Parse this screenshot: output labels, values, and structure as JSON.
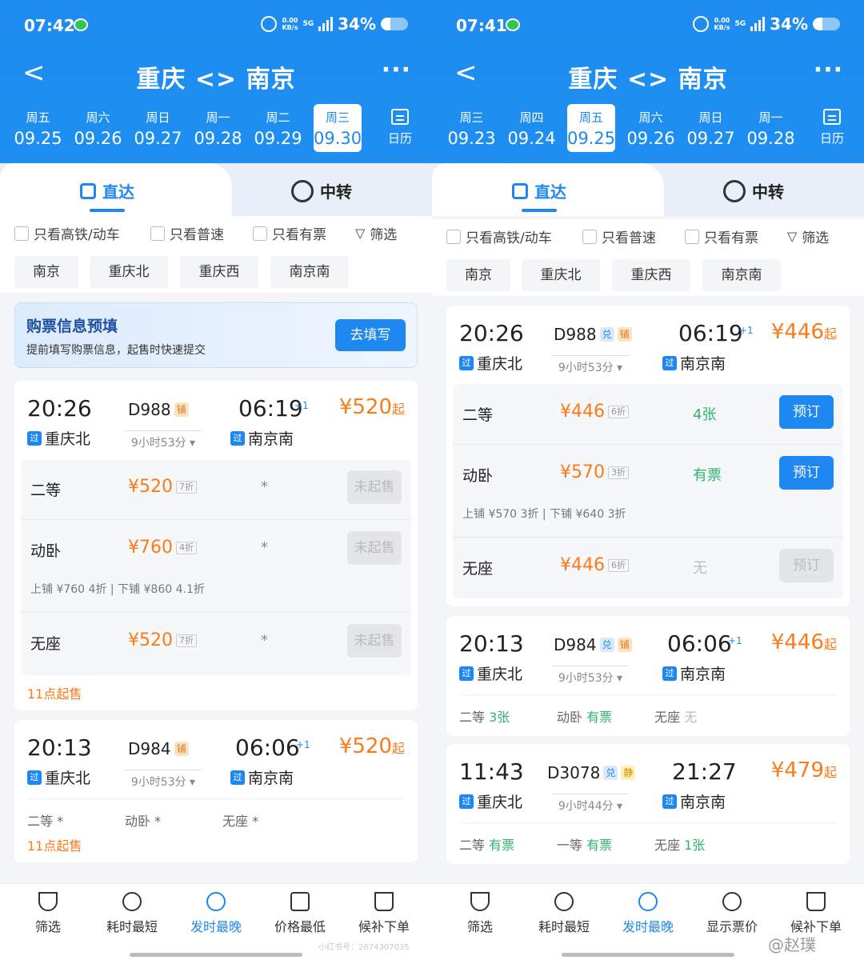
{
  "left": {
    "status": {
      "time": "07:42",
      "net": "0.00\nKB/s",
      "sig": "5G",
      "battery": "34%"
    },
    "nav": {
      "back": "<",
      "title": "重庆 <> 南京",
      "more": "···"
    },
    "dates": [
      {
        "wd": "周五",
        "dd": "09.25"
      },
      {
        "wd": "周六",
        "dd": "09.26"
      },
      {
        "wd": "周日",
        "dd": "09.27"
      },
      {
        "wd": "周一",
        "dd": "09.28"
      },
      {
        "wd": "周二",
        "dd": "09.29"
      },
      {
        "wd": "周三",
        "dd": "09.30"
      }
    ],
    "calendar": "日历",
    "tabs": {
      "direct": "直达",
      "transfer": "中转"
    },
    "filters": {
      "hs": "只看高铁/动车",
      "normal": "只看普速",
      "avail": "只看有票",
      "filter": "筛选"
    },
    "stations": [
      "南京",
      "重庆北",
      "重庆西",
      "南京南"
    ],
    "promo": {
      "title": "购票信息预填",
      "sub": "提前填写购票信息，起售时快速提交",
      "btn": "去填写"
    },
    "train1": {
      "dep": "20:26",
      "arr": "06:19",
      "plus": "+1",
      "no": "D988",
      "tag": "铺",
      "guo": "过",
      "from": "重庆北",
      "to": "南京南",
      "dur": "9小时53分 ▾",
      "price": "¥520",
      "qi": "起",
      "seats": [
        {
          "name": "二等",
          "price": "¥520",
          "disc": "7折",
          "avail": "*",
          "btn": "未起售"
        },
        {
          "name": "动卧",
          "price": "¥760",
          "disc": "4折",
          "avail": "*",
          "btn": "未起售"
        },
        {
          "name": "无座",
          "price": "¥520",
          "disc": "7折",
          "avail": "*",
          "btn": "未起售"
        }
      ],
      "berth": "上铺 ¥760 4折   |   下铺 ¥860 4.1折",
      "sale": "11点起售"
    },
    "train2": {
      "dep": "20:13",
      "arr": "06:06",
      "plus": "+1",
      "no": "D984",
      "tag": "铺",
      "guo": "过",
      "from": "重庆北",
      "to": "南京南",
      "dur": "9小时53分 ▾",
      "price": "¥520",
      "qi": "起",
      "summary": [
        "二等 *",
        "动卧 *",
        "无座 *"
      ],
      "sale": "11点起售"
    },
    "bottom": [
      "筛选",
      "耗时最短",
      "发时最晚",
      "价格最低",
      "候补下单"
    ],
    "watermark": "小红书号：2674307035"
  },
  "right": {
    "status": {
      "time": "07:41",
      "net": "0.00\nKB/s",
      "sig": "5G",
      "battery": "34%"
    },
    "nav": {
      "back": "<",
      "title": "重庆 <> 南京",
      "more": "···"
    },
    "dates": [
      {
        "wd": "周三",
        "dd": "09.23"
      },
      {
        "wd": "周四",
        "dd": "09.24"
      },
      {
        "wd": "周五",
        "dd": "09.25"
      },
      {
        "wd": "周六",
        "dd": "09.26"
      },
      {
        "wd": "周日",
        "dd": "09.27"
      },
      {
        "wd": "周一",
        "dd": "09.28"
      }
    ],
    "calendar": "日历",
    "tabs": {
      "direct": "直达",
      "transfer": "中转"
    },
    "filters": {
      "hs": "只看高铁/动车",
      "normal": "只看普速",
      "avail": "只看有票",
      "filter": "筛选"
    },
    "stations": [
      "南京",
      "重庆北",
      "重庆西",
      "南京南"
    ],
    "train1": {
      "dep": "20:26",
      "arr": "06:19",
      "plus": "+1",
      "no": "D988",
      "tag1": "兑",
      "tag2": "铺",
      "guo": "过",
      "from": "重庆北",
      "to": "南京南",
      "dur": "9小时53分 ▾",
      "price": "¥446",
      "qi": "起",
      "seats": [
        {
          "name": "二等",
          "price": "¥446",
          "disc": "6折",
          "avail": "4张",
          "btn": "预订"
        },
        {
          "name": "动卧",
          "price": "¥570",
          "disc": "3折",
          "avail": "有票",
          "btn": "预订"
        },
        {
          "name": "无座",
          "price": "¥446",
          "disc": "6折",
          "avail": "无",
          "btn": "预订"
        }
      ],
      "berth": "上铺 ¥570 3折   |   下铺 ¥640 3折"
    },
    "train2": {
      "dep": "20:13",
      "arr": "06:06",
      "plus": "+1",
      "no": "D984",
      "tag1": "兑",
      "tag2": "铺",
      "guo": "过",
      "from": "重庆北",
      "to": "南京南",
      "dur": "9小时53分 ▾",
      "price": "¥446",
      "qi": "起",
      "summary": [
        {
          "k": "二等",
          "v": "3张"
        },
        {
          "k": "动卧",
          "v": "有票"
        },
        {
          "k": "无座",
          "v": "无"
        }
      ]
    },
    "train3": {
      "dep": "11:43",
      "arr": "21:27",
      "no": "D3078",
      "tag1": "兑",
      "tag2": "静",
      "guo": "过",
      "from": "重庆北",
      "to": "南京南",
      "dur": "9小时44分 ▾",
      "price": "¥479",
      "qi": "起",
      "summary": [
        {
          "k": "二等",
          "v": "有票"
        },
        {
          "k": "一等",
          "v": "有票"
        },
        {
          "k": "无座",
          "v": "1张"
        }
      ]
    },
    "bottom": [
      "筛选",
      "耗时最短",
      "发时最晚",
      "显示票价",
      "候补下单"
    ],
    "watermark": "@赵璞"
  }
}
